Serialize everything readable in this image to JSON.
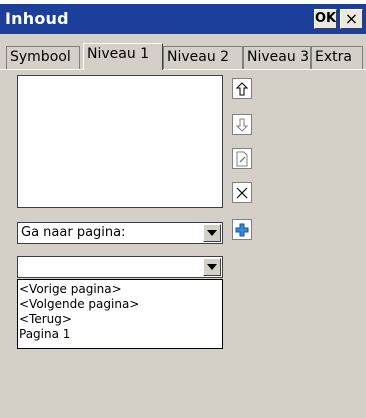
{
  "window": {
    "title": "Inhoud",
    "ok_label": "OK",
    "close_label": "×",
    "titlebar_color": "#1c3f9c"
  },
  "tabs": [
    {
      "label": "Symbool",
      "active": false
    },
    {
      "label": "Niveau 1",
      "active": true
    },
    {
      "label": "Niveau 2",
      "active": false
    },
    {
      "label": "Niveau 3",
      "active": false
    },
    {
      "label": "Extra",
      "active": false
    }
  ],
  "list": {
    "items": []
  },
  "side_buttons": [
    {
      "icon": "arrow-up-icon",
      "enabled": true
    },
    {
      "icon": "arrow-down-icon",
      "enabled": false
    },
    {
      "icon": "edit-page-icon",
      "enabled": false
    },
    {
      "icon": "delete-x-icon",
      "enabled": true
    },
    {
      "icon": "add-plus-icon",
      "enabled": true
    }
  ],
  "action_combo": {
    "value": "Ga naar pagina:"
  },
  "target_combo": {
    "value": "",
    "options": [
      "<Vorige pagina>",
      "<Volgende pagina>",
      "<Terug>",
      "Pagina 1"
    ]
  }
}
